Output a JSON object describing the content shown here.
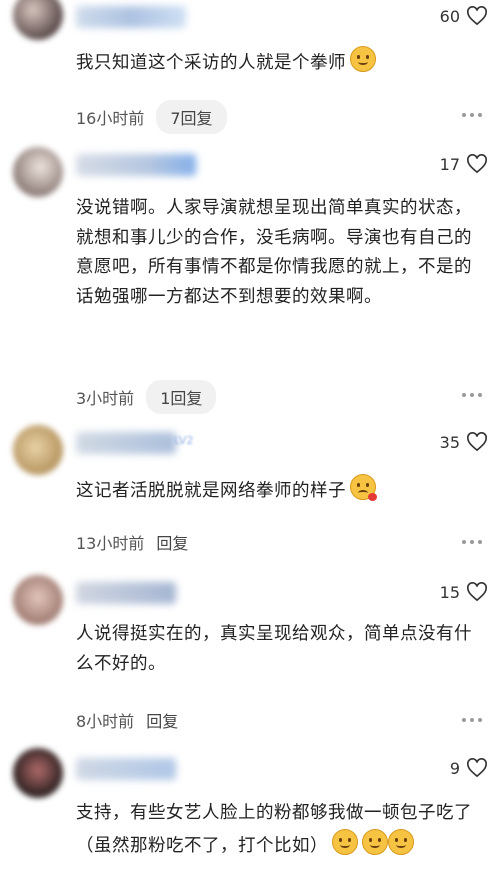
{
  "comments": [
    {
      "likes": "60",
      "text": "我只知道这个采访的人就是个拳师",
      "time": "16小时前",
      "reply": "7回复",
      "emoji": [
        "thinking-face"
      ]
    },
    {
      "likes": "17",
      "text": "没说错啊。人家导演就想呈现出简单真实的状态，就想和事儿少的合作，没毛病啊。导演也有自己的意愿吧，所有事情不都是你情我愿的就上，不是的话勉强哪一方都达不到想要的效果啊。",
      "time": "3小时前",
      "reply": "1回复"
    },
    {
      "likes": "35",
      "badge": "LV2",
      "text": "这记者活脱脱就是网络拳师的样子",
      "time": "13小时前",
      "reply": "回复",
      "emoji": [
        "vomiting-face"
      ]
    },
    {
      "likes": "15",
      "text": "人说得挺实在的，真实呈现给观众，简单点没有什么不好的。",
      "time": "8小时前",
      "reply": "回复"
    },
    {
      "likes": "9",
      "text": "支持，有些女艺人脸上的粉都够我做一顿包子吃了（虽然那粉吃不了，打个比如）",
      "emoji": [
        "worried-face",
        "worried-face",
        "worried-face"
      ]
    }
  ],
  "colors": {
    "pill_bg": "#f1f1f1",
    "text": "#222222",
    "meta": "#555555"
  }
}
